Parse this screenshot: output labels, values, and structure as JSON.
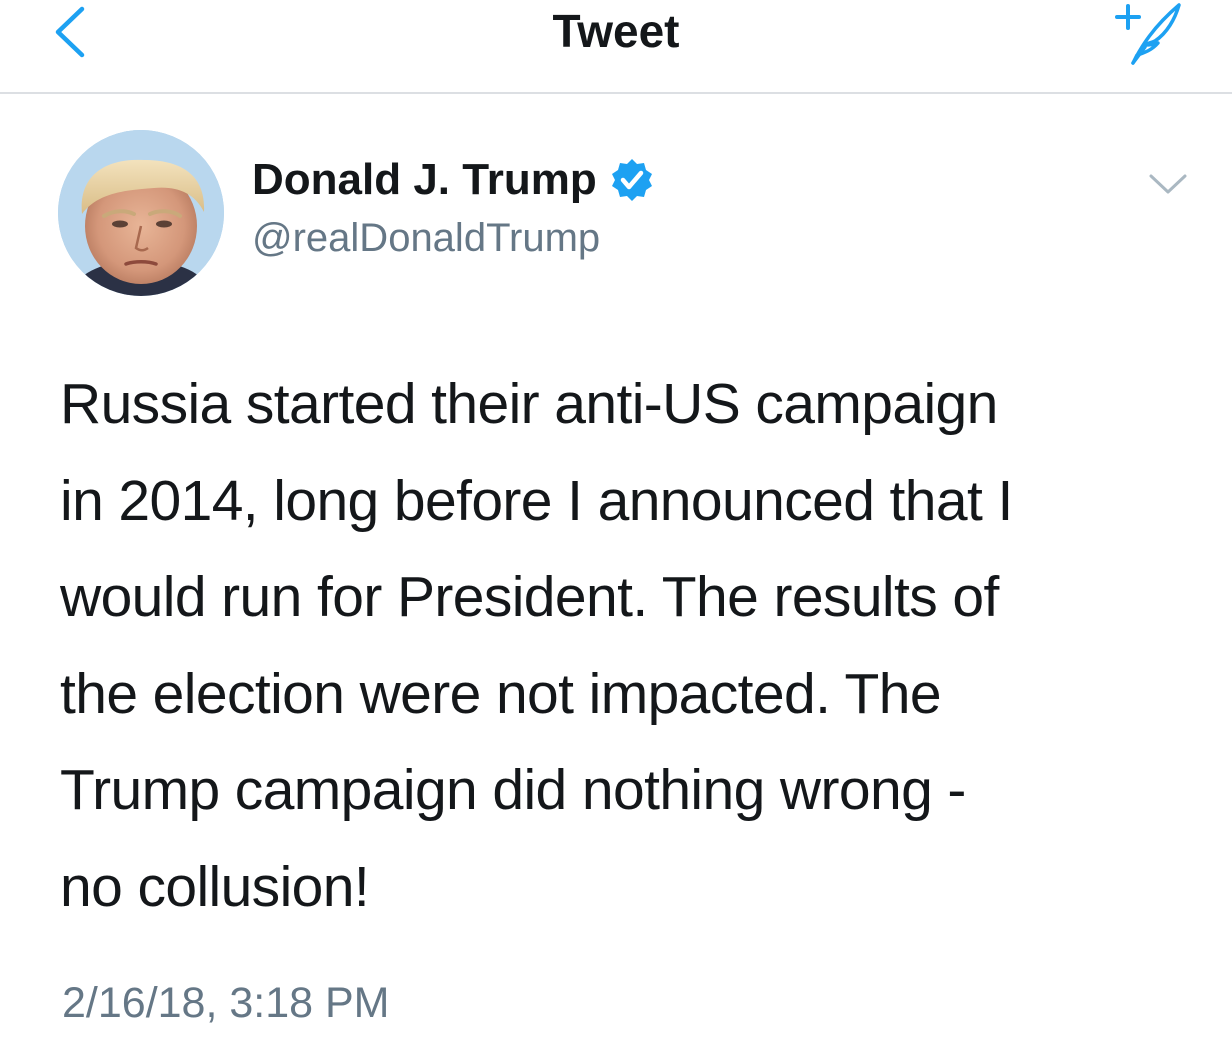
{
  "nav": {
    "title": "Tweet",
    "back_icon": "chevron-left-icon",
    "compose_icon": "compose-tweet-feather-icon",
    "accent_color": "#1da1f2"
  },
  "tweet": {
    "author": {
      "name": "Donald J. Trump",
      "handle": "@realDonaldTrump",
      "verified": true,
      "verified_icon": "verified-badge-icon"
    },
    "menu_icon": "chevron-down-icon",
    "text_lines": [
      "Russia started their anti-US campaign",
      "in 2014, long before I announced that I",
      "would run for President. The results of",
      "the election were not impacted. The",
      "Trump campaign did nothing wrong -",
      "no collusion!"
    ],
    "timestamp": "2/16/18, 3:18 PM"
  },
  "colors": {
    "primary_text": "#14171a",
    "secondary_text": "#657786",
    "accent": "#1da1f2",
    "divider": "#dcdfe3"
  }
}
